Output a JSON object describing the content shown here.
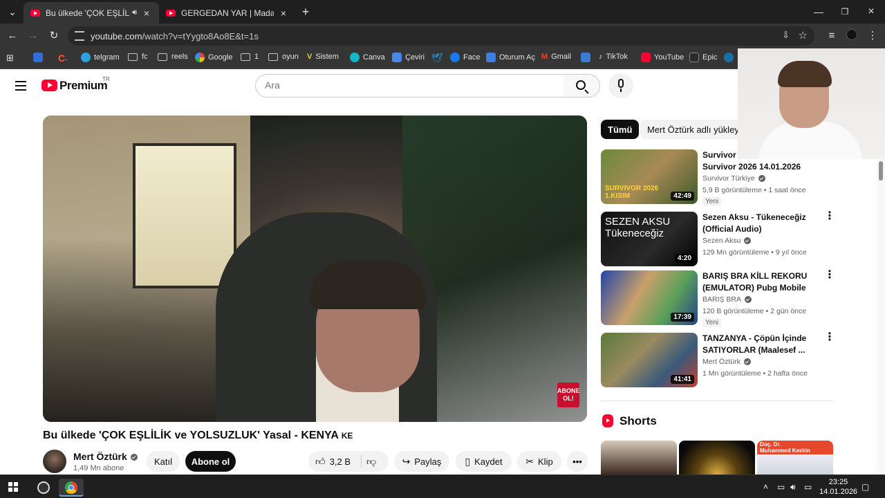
{
  "browser": {
    "tabs": [
      {
        "title": "Bu ülkede 'ÇOK EŞLİLİK ve YOLSUZLUK' Yasal - KENYA",
        "active": true,
        "audio": true
      },
      {
        "title": "GERGEDAN YAR | Madara Oldu",
        "active": false
      }
    ],
    "new_tab": "+",
    "url_host": "youtube.com",
    "url_rest": "/watch?v=tYygto8Ao8E&t=1s",
    "bookmarks": [
      "telgram",
      "fc",
      "reels",
      "Google",
      "1",
      "oyun",
      "Sistem",
      "Canva",
      "Çeviri",
      "Face",
      "Oturum Aç",
      "Gmail",
      "TikTok",
      "YouTube",
      "Epic"
    ]
  },
  "youtube": {
    "brand": "Premium",
    "brand_region": "TR",
    "search_placeholder": "Ara",
    "badge_text": "ABONE OL!",
    "video": {
      "title": "Bu ülkede 'ÇOK EŞLİLİK ve YOLSUZLUK' Yasal - KENYA",
      "title_suffix": "KE",
      "channel": "Mert Öztürk",
      "subscribers": "1,49 Mn abone",
      "join": "Katıl",
      "subscribe": "Abone ol",
      "likes": "3,2 B",
      "share": "Paylaş",
      "save": "Kaydet",
      "clip": "Klip"
    },
    "chips": [
      "Tümü",
      "Mert Öztürk adlı yükleyici"
    ],
    "recommendations": [
      {
        "title": "Survivor 2026 | Survivor 2026 14.01.2026",
        "title_visible": "Survivor 2\nSurvivor 2026 14.01.2026",
        "channel": "Survivor Türkiye",
        "meta": "5,9 B görüntüleme • 1 saat önce",
        "badge": "Yeni",
        "duration": "42:49",
        "thumb_label": "SURVIVOR 2026\n1.KISIM"
      },
      {
        "title": "Sezen Aksu - Tükeneceğiz (Official Audio)",
        "channel": "Sezen Aksu",
        "meta": "129 Mn görüntüleme • 9 yıl önce",
        "badge": "",
        "duration": "4:20",
        "thumb_label": "SEZEN AKSU\nTükeneceğiz"
      },
      {
        "title": "BARIŞ BRA KİLL REKORU (EMULATOR) Pubg Mobile",
        "channel": "BARIŞ BRA",
        "meta": "120 B görüntüleme • 2 gün önce",
        "badge": "Yeni",
        "duration": "17:39",
        "thumb_label": ""
      },
      {
        "title": "TANZANYA - Çöpün İçinde SATIYORLAR (Maalesef ...",
        "channel": "Mert Öztürk",
        "meta": "1 Mn görüntüleme • 2 hafta önce",
        "badge": "",
        "duration": "41:41",
        "thumb_label": ""
      }
    ],
    "shorts_title": "Shorts",
    "shorts_thumb_text": "Doç. Dr.\nMuhammed Keskin"
  },
  "taskbar": {
    "time": "23:25",
    "date": "14.01.2026"
  },
  "colors": {
    "youtube_red": "#ff0033",
    "chrome_dark": "#1f1f1f",
    "chrome_toolbar": "#353535"
  }
}
